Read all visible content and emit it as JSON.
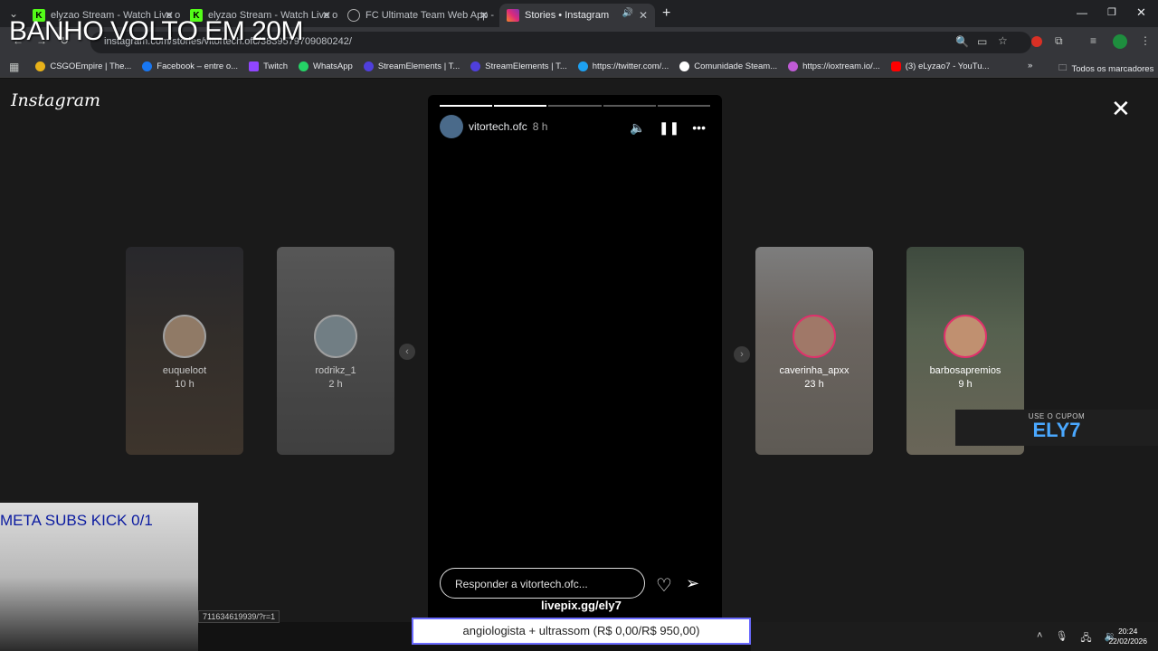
{
  "tabs": [
    {
      "title": "elyzao Stream - Watch Live on",
      "active": false
    },
    {
      "title": "elyzao Stream - Watch Live on",
      "active": false
    },
    {
      "title": "FC Ultimate Team Web App - E",
      "active": false
    },
    {
      "title": "Stories • Instagram",
      "active": true
    }
  ],
  "address": {
    "url": "instagram.com/stories/vitortech.ofc/3839579709080242/"
  },
  "bookmarks": [
    {
      "label": "CSGOEmpire | The...",
      "color": "#e8b21a"
    },
    {
      "label": "Facebook – entre o...",
      "color": "#1877f2"
    },
    {
      "label": "Twitch",
      "color": "#9146ff"
    },
    {
      "label": "WhatsApp",
      "color": "#25d366"
    },
    {
      "label": "StreamElements | T...",
      "color": "#4f3fdc"
    },
    {
      "label": "StreamElements | T...",
      "color": "#4f3fdc"
    },
    {
      "label": "https://twitter.com/...",
      "color": "#1da1f2"
    },
    {
      "label": "Comunidade Steam...",
      "color": "#ffffff"
    },
    {
      "label": "https://ioxtream.io/...",
      "color": "#c05bd6"
    },
    {
      "label": "(3) eLyzao7 - YouTu...",
      "color": "#ff0000"
    }
  ],
  "bookmarks_all": "Todos os marcadores",
  "instagram": {
    "logo": "Instagram",
    "stories_left": [
      {
        "user": "euqueloot",
        "time": "10 h"
      },
      {
        "user": "rodrikz_1",
        "time": "2 h"
      }
    ],
    "stories_right": [
      {
        "user": "caverinha_apxx",
        "time": "23 h"
      },
      {
        "user": "barbosapremios",
        "time": "9 h"
      }
    ],
    "current": {
      "user": "vitortech.ofc",
      "time": "8 h",
      "progress_segments": 5,
      "completed_segments": 2
    },
    "reply_placeholder": "Responder a vitortech.ofc..."
  },
  "overlay": {
    "title": "BANHO VOLTO EM 20M",
    "meta_subs": "META SUBS KICK 0/1",
    "coupon_small": "USE O CUPOM",
    "coupon_code": "ELY7",
    "livepix": "livepix.gg/ely7",
    "goal": "angiologista + ultrassom (R$ 0,00/R$ 950,00)"
  },
  "status_url": "711634619939/?r=1",
  "taskbar": {
    "time": "20:24",
    "date": "22/02/2026"
  }
}
